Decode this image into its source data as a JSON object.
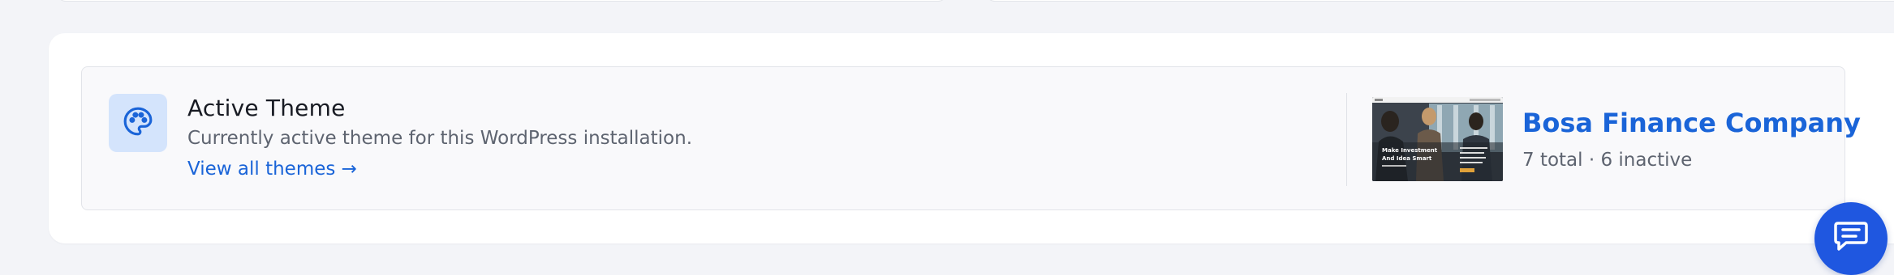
{
  "active_theme": {
    "title": "Active Theme",
    "description": "Currently active theme for this WordPress installation.",
    "view_all_link": "View all themes →",
    "theme_name": "Bosa Finance Company",
    "theme_stats": "7 total · 6 inactive",
    "thumbnail": {
      "headline_line1": "Make Investment",
      "headline_line2": "And Idea Smart"
    }
  },
  "icons": {
    "theme_icon": "palette-icon",
    "chat_icon": "chat-bubble-icon"
  },
  "colors": {
    "accent": "#1a64d8",
    "icon_tile": "#d4e4fc",
    "chat_button": "#1f57e0",
    "page_background": "#f3f4f8"
  }
}
